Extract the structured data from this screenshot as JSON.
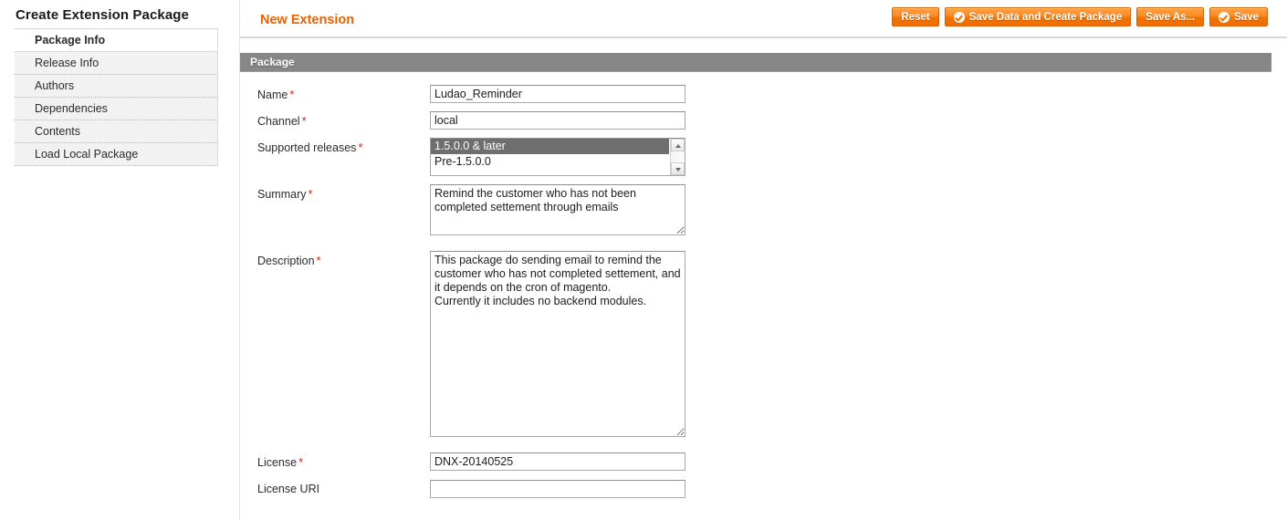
{
  "sidebar": {
    "title": "Create Extension Package",
    "items": [
      {
        "label": "Package Info",
        "active": true
      },
      {
        "label": "Release Info",
        "active": false
      },
      {
        "label": "Authors",
        "active": false
      },
      {
        "label": "Dependencies",
        "active": false
      },
      {
        "label": "Contents",
        "active": false
      },
      {
        "label": "Load Local Package",
        "active": false
      }
    ]
  },
  "header": {
    "page_title": "New Extension",
    "buttons": [
      {
        "label": "Reset",
        "icon": "none"
      },
      {
        "label": "Save Data and Create Package",
        "icon": "check-circle-icon"
      },
      {
        "label": "Save As...",
        "icon": "none"
      },
      {
        "label": "Save",
        "icon": "check-circle-icon"
      }
    ],
    "accent_color": "#ea6100",
    "button_color": "#f07000"
  },
  "panel": {
    "header": "Package",
    "header_color": "#878787",
    "required_marker": "*",
    "required_color": "#d81e00",
    "fields": {
      "name": {
        "label": "Name",
        "required": true,
        "value": "Ludao_Reminder",
        "placeholder": ""
      },
      "channel": {
        "label": "Channel",
        "required": true,
        "value": "local",
        "placeholder": ""
      },
      "supported_releases": {
        "label": "Supported releases",
        "required": true,
        "options": [
          {
            "label": "1.5.0.0 & later",
            "selected": true
          },
          {
            "label": "Pre-1.5.0.0",
            "selected": false
          }
        ]
      },
      "summary": {
        "label": "Summary",
        "required": true,
        "value": "Remind the customer who has not been completed settement through emails",
        "placeholder": ""
      },
      "description": {
        "label": "Description",
        "required": true,
        "value": "This package do sending email to remind the customer who has not completed settement, and it depends on the cron of magento.\nCurrently it includes no backend modules.",
        "placeholder": ""
      },
      "license": {
        "label": "License",
        "required": true,
        "value": "DNX-20140525",
        "placeholder": ""
      },
      "license_uri": {
        "label": "License URI",
        "required": false,
        "value": "",
        "placeholder": ""
      }
    }
  }
}
